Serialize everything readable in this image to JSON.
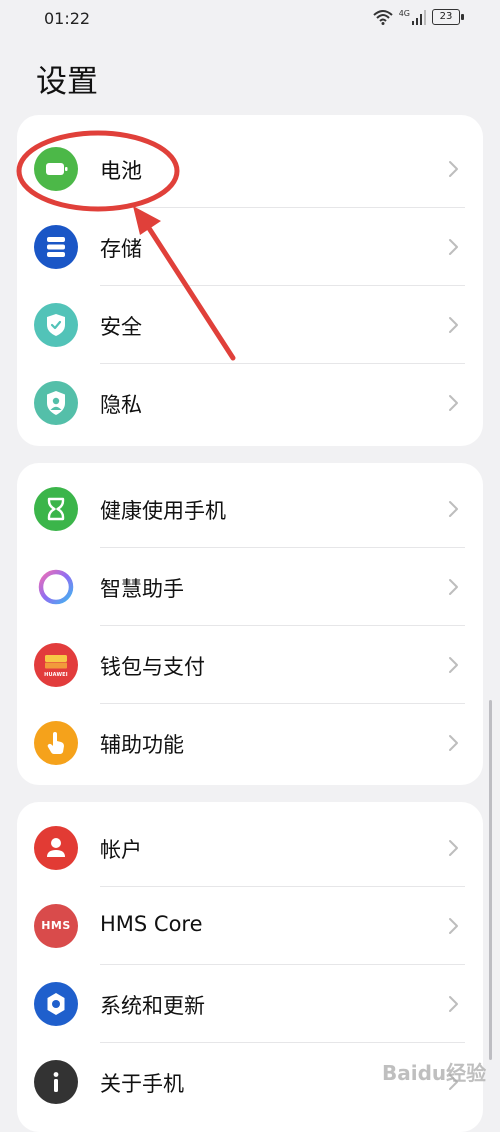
{
  "status_bar": {
    "time": "01:22",
    "battery": "23",
    "network": "4G"
  },
  "page": {
    "title": "设置"
  },
  "groups": [
    {
      "items": [
        {
          "label": "电池",
          "icon": "battery-icon",
          "color": "#4cb848"
        },
        {
          "label": "存储",
          "icon": "storage-icon",
          "color": "#1a56c6"
        },
        {
          "label": "安全",
          "icon": "shield-icon",
          "color": "#52c3b8"
        },
        {
          "label": "隐私",
          "icon": "privacy-icon",
          "color": "#54bfa9"
        }
      ]
    },
    {
      "items": [
        {
          "label": "健康使用手机",
          "icon": "hourglass-icon",
          "color": "#3bb54a"
        },
        {
          "label": "智慧助手",
          "icon": "assistant-ring-icon",
          "color": "#a36ef0"
        },
        {
          "label": "钱包与支付",
          "icon": "wallet-icon",
          "color": "#e23c3c"
        },
        {
          "label": "辅助功能",
          "icon": "hand-icon",
          "color": "#f5a21b"
        }
      ]
    },
    {
      "items": [
        {
          "label": "帐户",
          "icon": "account-icon",
          "color": "#e23b34"
        },
        {
          "label": "HMS Core",
          "icon": "hms-icon",
          "color": "#d94b4b"
        },
        {
          "label": "系统和更新",
          "icon": "gear-icon",
          "color": "#1f5fcc"
        },
        {
          "label": "关于手机",
          "icon": "info-icon",
          "color": "#333333"
        }
      ]
    }
  ],
  "icon_text": {
    "wallet_brand": "HUAWEI",
    "hms": "HMS"
  },
  "annotation": {
    "color": "#e0403a"
  },
  "watermark": {
    "text": "Baidu经验"
  }
}
